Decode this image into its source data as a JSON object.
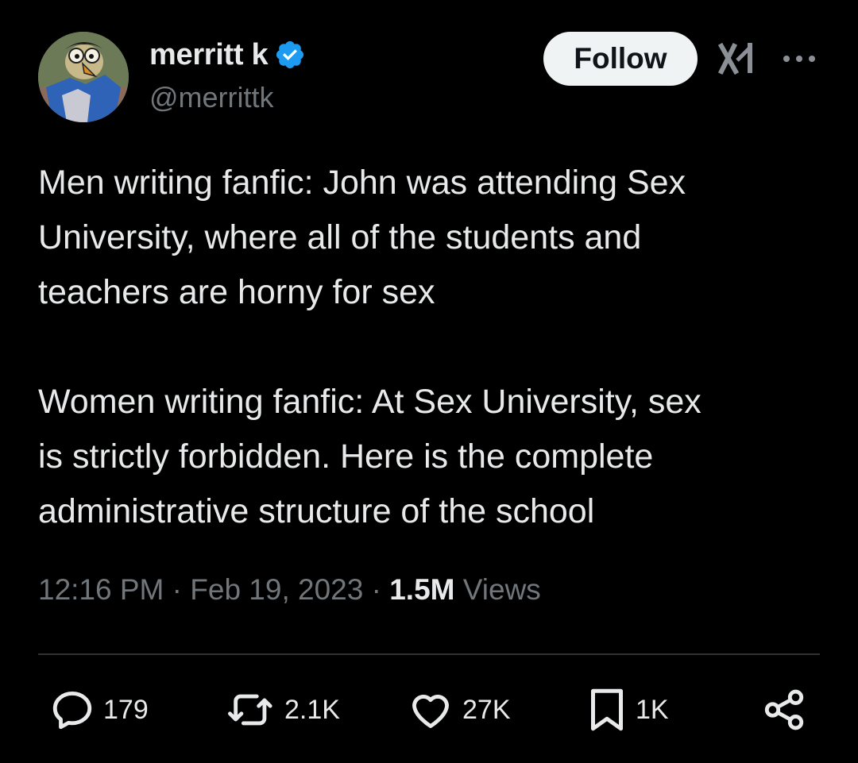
{
  "author": {
    "display_name": "merritt k",
    "handle": "@merrittk",
    "verified": true
  },
  "header": {
    "follow_label": "Follow"
  },
  "tweet": {
    "text": "Men writing fanfic: John was attending Sex\nUniversity, where all of the students and\nteachers are horny for sex\n\nWomen writing fanfic: At Sex University, sex\nis strictly forbidden. Here is the complete\nadministrative structure of the school"
  },
  "meta": {
    "time": "12:16 PM",
    "separator": " · ",
    "date": "Feb 19, 2023",
    "views_count": "1.5M",
    "views_label": " Views"
  },
  "actions": {
    "replies": "179",
    "reposts": "2.1K",
    "likes": "27K",
    "bookmarks": "1K"
  },
  "icons": {
    "reply": "speech-bubble-icon",
    "repost": "repost-arrows-icon",
    "like": "heart-icon",
    "bookmark": "bookmark-icon",
    "share": "share-nodes-icon",
    "grok": "grok-icon",
    "more": "more-dots-icon",
    "verified": "verified-badge-icon"
  },
  "colors": {
    "background": "#000000",
    "text_primary": "#e7e9ea",
    "text_secondary": "#71767b",
    "verified_blue": "#1d9bf0",
    "follow_bg": "#eff3f4",
    "divider": "#2f3336"
  }
}
